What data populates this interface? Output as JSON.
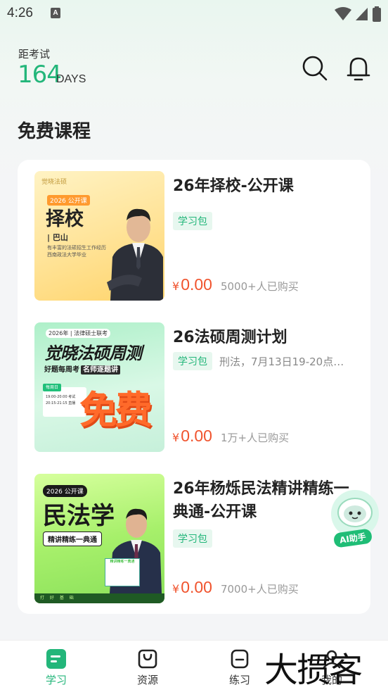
{
  "status_bar": {
    "time": "4:26",
    "notification_badge": "A"
  },
  "header": {
    "countdown_label": "距考试",
    "countdown_value": "164",
    "countdown_unit": "DAYS",
    "search_icon": "search-icon",
    "bell_icon": "bell-icon"
  },
  "section": {
    "title": "免费课程"
  },
  "courses": [
    {
      "title": "26年择校-公开课",
      "tag": "学习包",
      "tag_desc": "",
      "price_symbol": "¥",
      "price": "0.00",
      "buyers": "5000+人已购买",
      "thumb": {
        "brand": "觉晓法硕",
        "year": "2026 公开课",
        "headline": "择校",
        "teacher": "| 巴山",
        "desc_lines": [
          "有丰富的法硕招生工作经历",
          "西南政法大学毕业"
        ]
      }
    },
    {
      "title": "26法硕周测计划",
      "tag": "学习包",
      "tag_desc": "刑法，7月13日19-20点…",
      "price_symbol": "¥",
      "price": "0.00",
      "buyers": "1万+人已购买",
      "thumb": {
        "top": "2026年 | 法律硕士联考",
        "headline": "觉晓法硕周测",
        "sub": "好题每周考",
        "sub_badge": "名师逐题讲",
        "schedule_head": "每周日",
        "schedule_lines": [
          "19:00-20:00 考试",
          "20:15-21:15 直播"
        ],
        "free": "免费"
      }
    },
    {
      "title": "26年杨烁民法精讲精练一典通-公开课",
      "tag": "学习包",
      "tag_desc": "",
      "price_symbol": "¥",
      "price": "0.00",
      "buyers": "7000+人已购买",
      "thumb": {
        "year": "2026 公开课",
        "headline": "民法学",
        "sub": "精讲精练一典通",
        "book": "精讲精练一典通",
        "foot": "打 好 基 础"
      }
    }
  ],
  "ai_helper": {
    "label": "AI助手"
  },
  "bottom_nav": [
    {
      "label": "学习",
      "icon": "study-icon",
      "active": true
    },
    {
      "label": "资源",
      "icon": "bag-icon",
      "active": false
    },
    {
      "label": "练习",
      "icon": "practice-icon",
      "active": false
    },
    {
      "label": "我的",
      "icon": "profile-icon",
      "active": false
    }
  ],
  "watermark": "大掼客",
  "colors": {
    "accent": "#23b67a",
    "price": "#f0532d"
  }
}
